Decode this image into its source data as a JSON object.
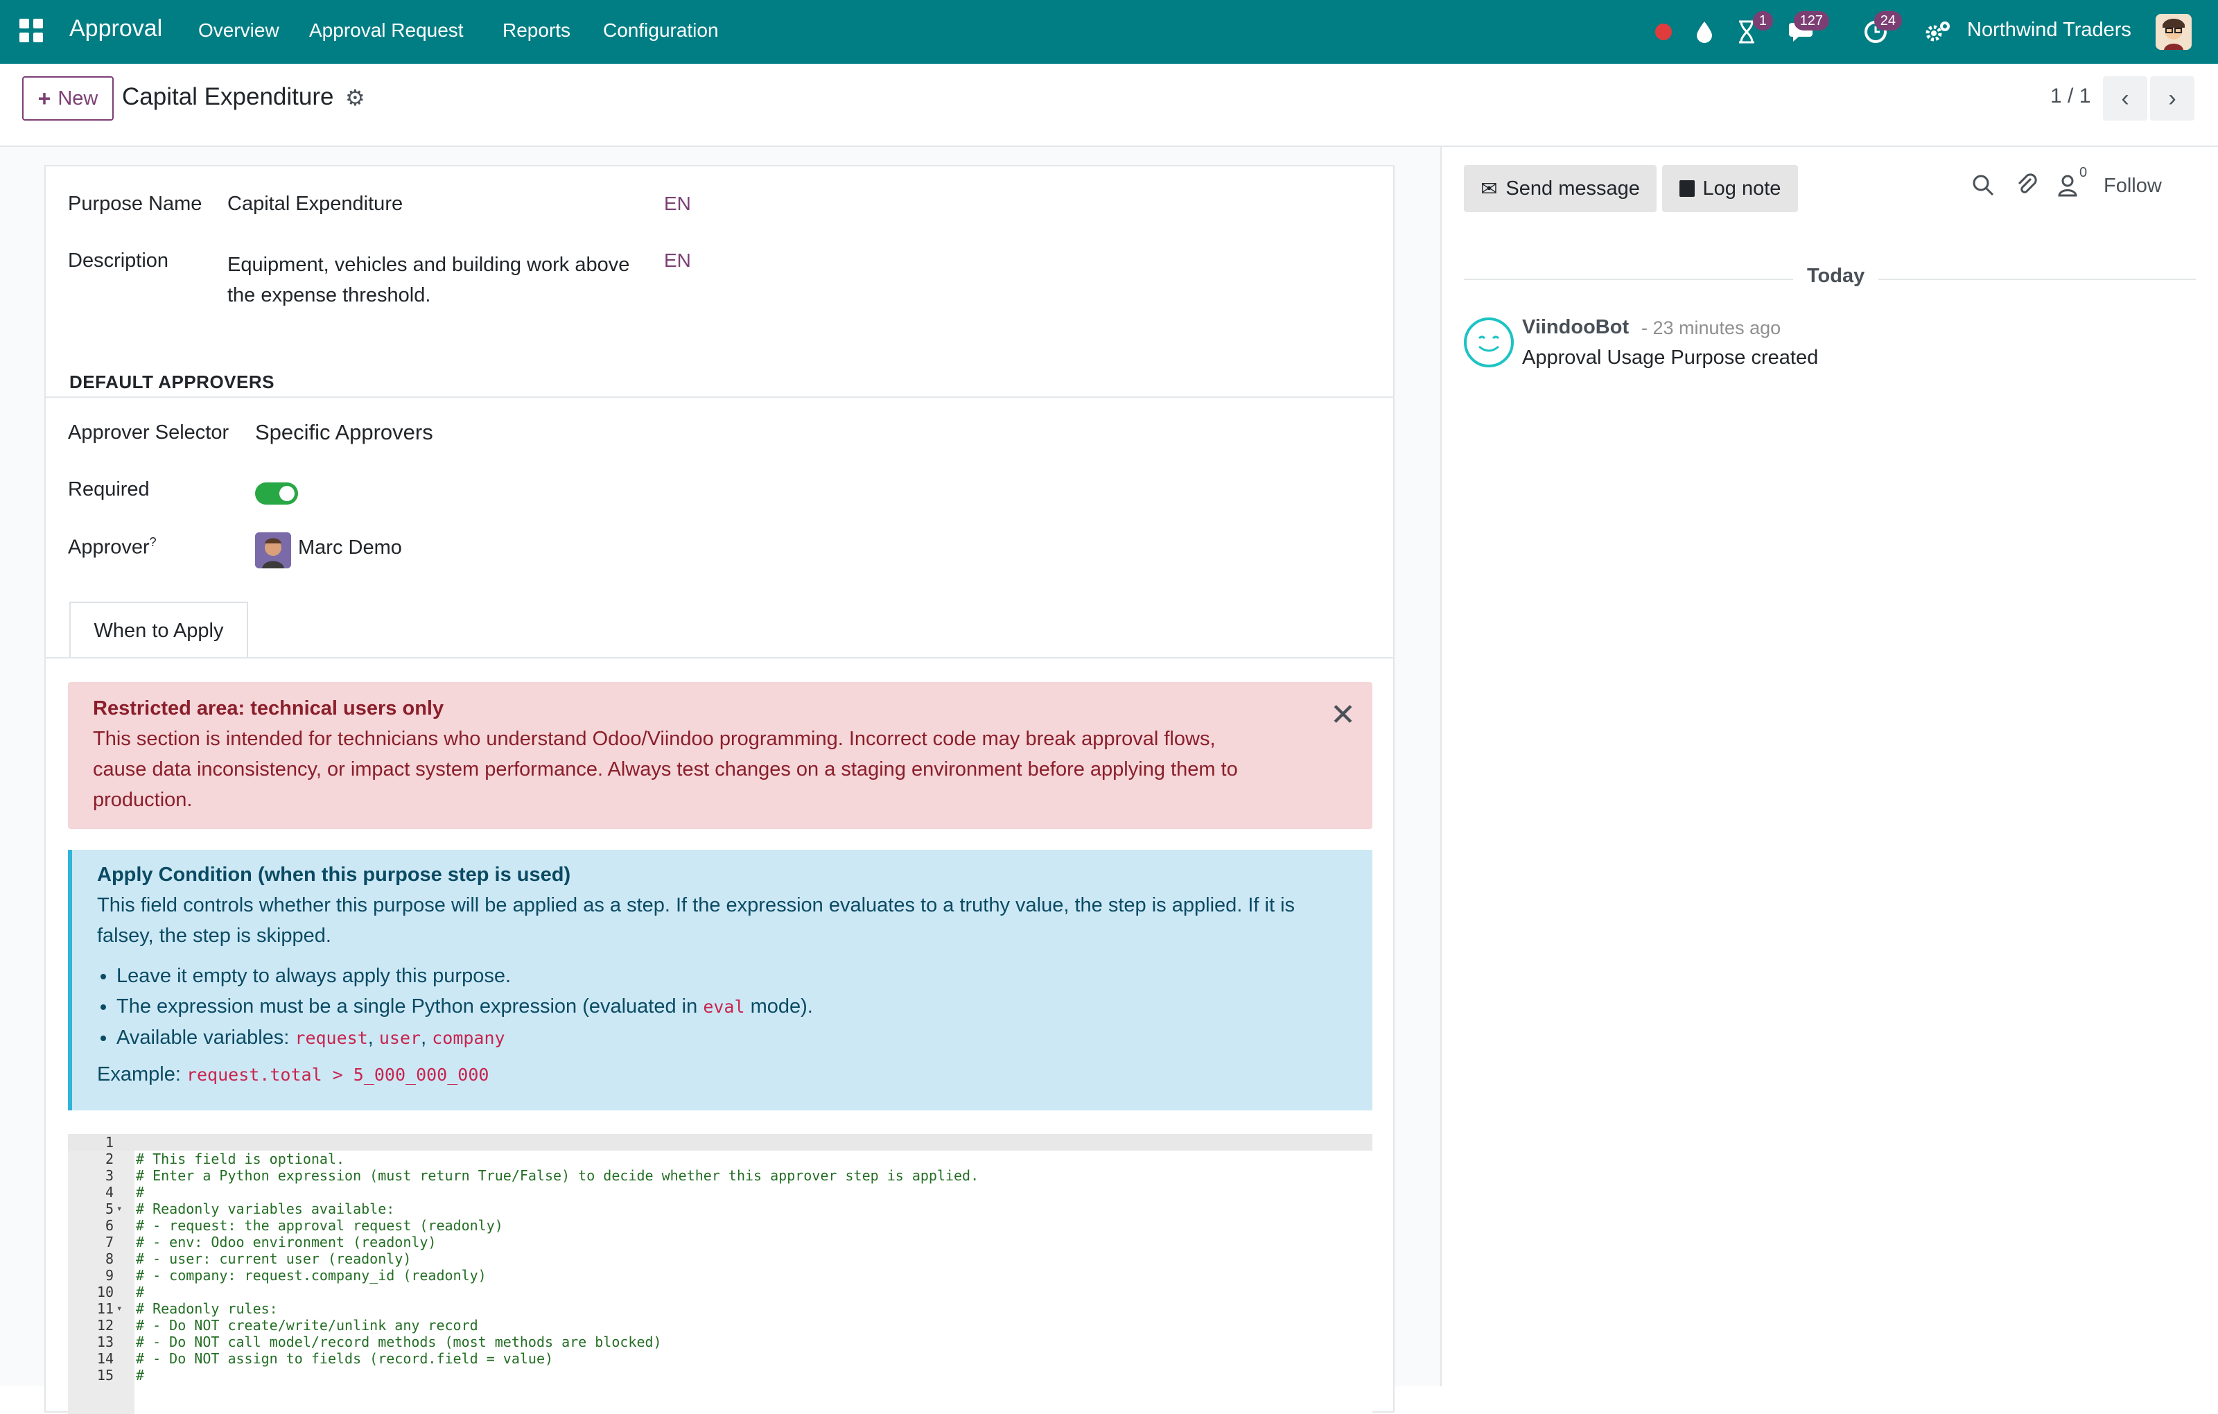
{
  "topbar": {
    "app_name": "Approval",
    "menu": [
      "Overview",
      "Approval Request",
      "Reports",
      "Configuration"
    ],
    "badges": {
      "activities": "1",
      "messages": "127",
      "updates": "24"
    },
    "company": "Northwind Traders",
    "bg_color": "#017e84"
  },
  "control": {
    "new_label": "New",
    "breadcrumb": "Capital Expenditure",
    "pager": "1 / 1"
  },
  "form": {
    "purpose_name_label": "Purpose Name",
    "purpose_name_value": "Capital Expenditure",
    "lang_tag": "EN",
    "description_label": "Description",
    "description_value_line1": "Equipment, vehicles and building work above",
    "description_value_line2": "the expense threshold.",
    "section_title": "DEFAULT APPROVERS",
    "approver_selector_label": "Approver Selector",
    "approver_selector_value": "Specific Approvers",
    "required_label": "Required",
    "required_value": true,
    "approver_label": "Approver",
    "approver_help": "?",
    "approver_value": "Marc Demo",
    "tab_label": "When to Apply"
  },
  "alert_restricted": {
    "title": "Restricted area: technical users only",
    "line1": "This section is intended for technicians who understand Odoo/Viindoo programming. Incorrect code may break approval flows,",
    "line2": "cause data inconsistency, or impact system performance. Always test changes on a staging environment before applying them to",
    "line3": "production."
  },
  "alert_condition": {
    "title": "Apply Condition (when this purpose step is used)",
    "line1": "This field controls whether this purpose will be applied as a step. If the expression evaluates to a truthy value, the step is applied. If it is",
    "line2": "falsey, the step is skipped.",
    "bullet1": "Leave it empty to always apply this purpose.",
    "bullet2_pre": "The expression must be a single Python expression (evaluated in ",
    "bullet2_code": "eval",
    "bullet2_post": " mode).",
    "bullet3_pre": "Available variables: ",
    "var1": "request",
    "var2": "user",
    "var3": "company",
    "example_label": "Example: ",
    "example_code": "request.total > 5_000_000_000"
  },
  "editor": {
    "lines": [
      "",
      "# This field is optional.",
      "# Enter a Python expression (must return True/False) to decide whether this approver step is applied.",
      "#",
      "# Readonly variables available:",
      "# - request: the approval request (readonly)",
      "# - env: Odoo environment (readonly)",
      "# - user: current user (readonly)",
      "# - company: request.company_id (readonly)",
      "#",
      "# Readonly rules:",
      "# - Do NOT create/write/unlink any record",
      "# - Do NOT call model/record methods (most methods are blocked)",
      "# - Do NOT assign to fields (record.field = value)",
      "#"
    ]
  },
  "chatter": {
    "send_message": "Send message",
    "log_note": "Log note",
    "follower_count": "0",
    "follow": "Follow",
    "today": "Today",
    "author": "ViindooBot",
    "time": "- 23 minutes ago",
    "body": "Approval Usage Purpose created"
  }
}
